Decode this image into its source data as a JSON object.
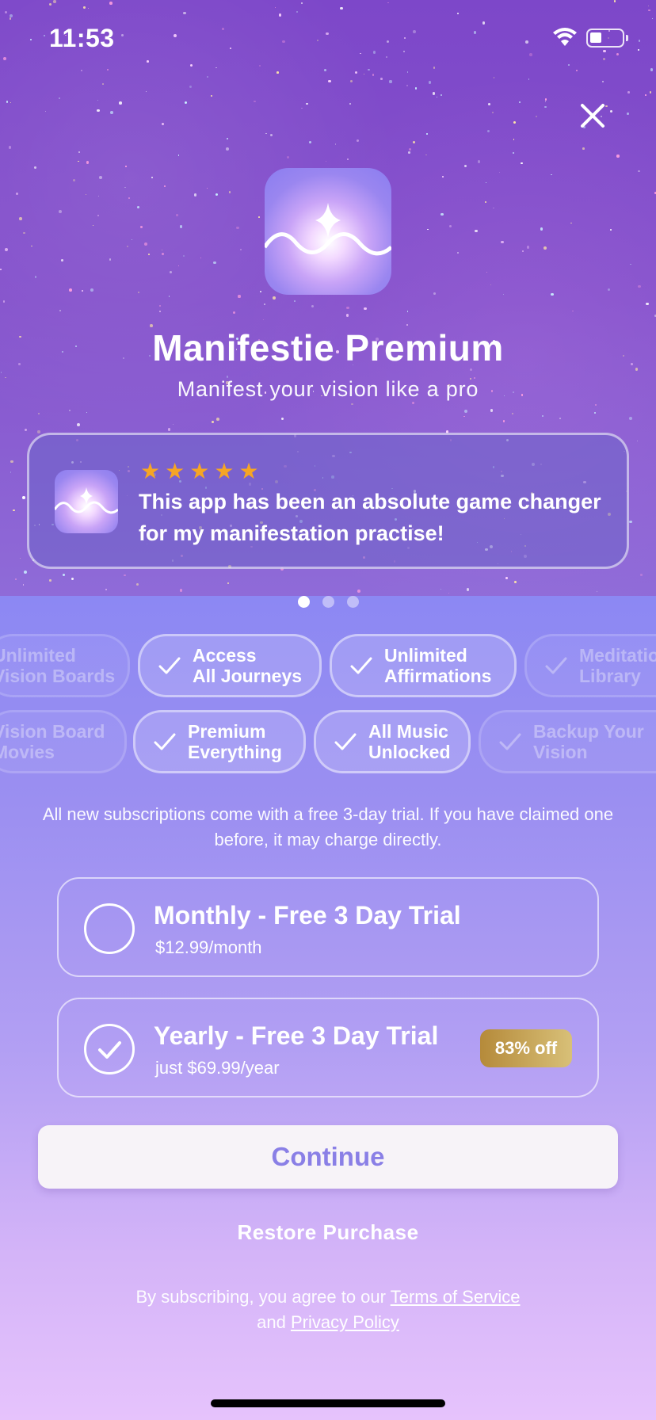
{
  "status_bar": {
    "time": "11:53"
  },
  "header": {
    "title": "Manifestie Premium",
    "subtitle": "Manifest your vision like a pro"
  },
  "review": {
    "stars": 5,
    "text": "This app has been an absolute game changer for my manifestation practise!"
  },
  "carousel": {
    "pages": 3,
    "active_index": 0
  },
  "features": {
    "row1": [
      {
        "label": "Unlimited\nVision Boards",
        "faded": true
      },
      {
        "label": "Access\nAll Journeys",
        "faded": false
      },
      {
        "label": "Unlimited\nAffirmations",
        "faded": false
      },
      {
        "label": "Meditation\nLibrary",
        "faded": true
      }
    ],
    "row2": [
      {
        "label": "Vision Board\nMovies",
        "faded": true
      },
      {
        "label": "Premium\nEverything",
        "faded": false
      },
      {
        "label": "All Music\nUnlocked",
        "faded": false
      },
      {
        "label": "Backup Your\nVision",
        "faded": true
      }
    ]
  },
  "trial_note": "All new subscriptions come with a free 3-day trial. If you have claimed one before, it may charge directly.",
  "plans": [
    {
      "title": "Monthly - Free 3 Day Trial",
      "price": "$12.99/month",
      "selected": false,
      "badge": ""
    },
    {
      "title": "Yearly - Free 3 Day Trial",
      "price": "just $69.99/year",
      "selected": true,
      "badge": "83% off"
    }
  ],
  "buttons": {
    "continue": "Continue",
    "restore": "Restore Purchase"
  },
  "legal": {
    "prefix": "By subscribing, you agree to our",
    "terms": "Terms of Service",
    "and": "and",
    "privacy": "Privacy Policy"
  },
  "colors": {
    "accent": "#8a7fe6",
    "star": "#f6a524",
    "badge_start": "#b58a3a",
    "badge_end": "#d8c078"
  }
}
